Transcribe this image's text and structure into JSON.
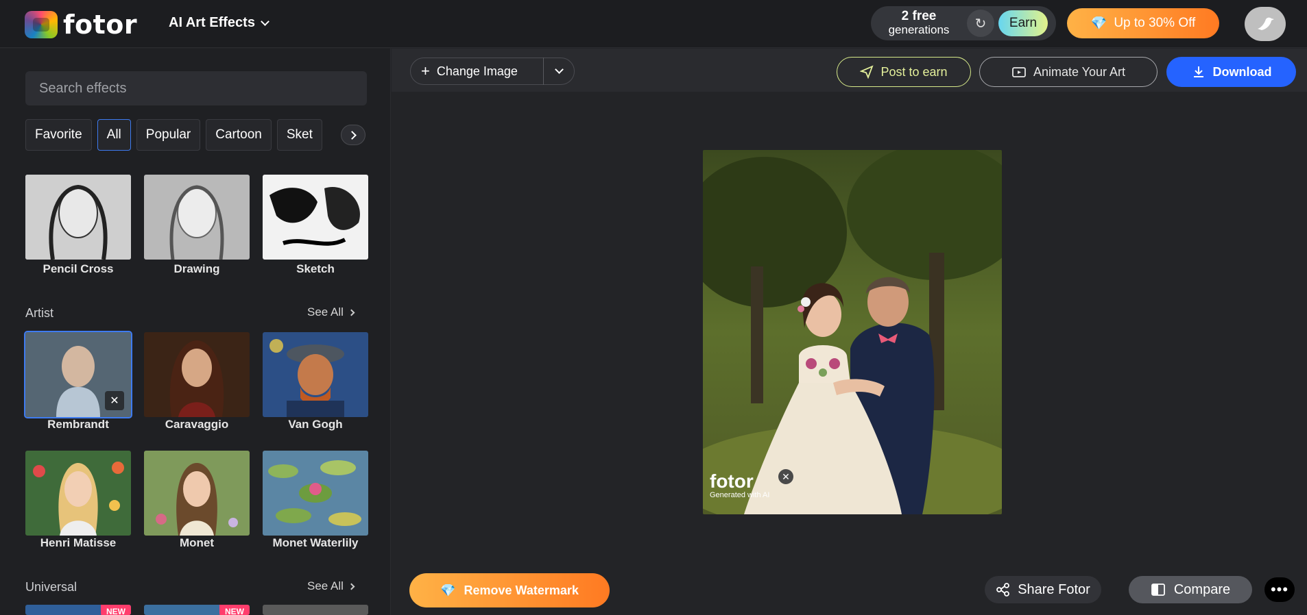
{
  "header": {
    "logo_text": "fotor",
    "menu_title": "AI Art Effects",
    "credits_line1": "2 free",
    "credits_line2": "generations",
    "earn_label": "Earn",
    "promo_label": "Up to 30% Off"
  },
  "sidebar": {
    "search_placeholder": "Search effects",
    "categories": [
      "Favorite",
      "All",
      "Popular",
      "Cartoon",
      "Sket"
    ],
    "top_effects": [
      "Pencil Cross",
      "Drawing",
      "Sketch"
    ],
    "artist_section": "Artist",
    "see_all": "See All",
    "artist_effects": [
      "Rembrandt",
      "Caravaggio",
      "Van Gogh",
      "Henri Matisse",
      "Monet",
      "Monet Waterlily"
    ],
    "universal_section": "Universal",
    "new_badge": "NEW"
  },
  "toolbar": {
    "change_image": "Change Image",
    "post_to_earn": "Post to earn",
    "animate": "Animate Your Art",
    "download": "Download"
  },
  "canvas": {
    "watermark_logo": "fotor",
    "watermark_caption": "Generated with AI"
  },
  "footer": {
    "remove_watermark": "Remove Watermark",
    "share": "Share Fotor",
    "compare": "Compare"
  },
  "colors": {
    "accent_blue": "#2563ff",
    "promo_orange": "#ff7a22",
    "earn_gradient_start": "#67d6f0"
  }
}
